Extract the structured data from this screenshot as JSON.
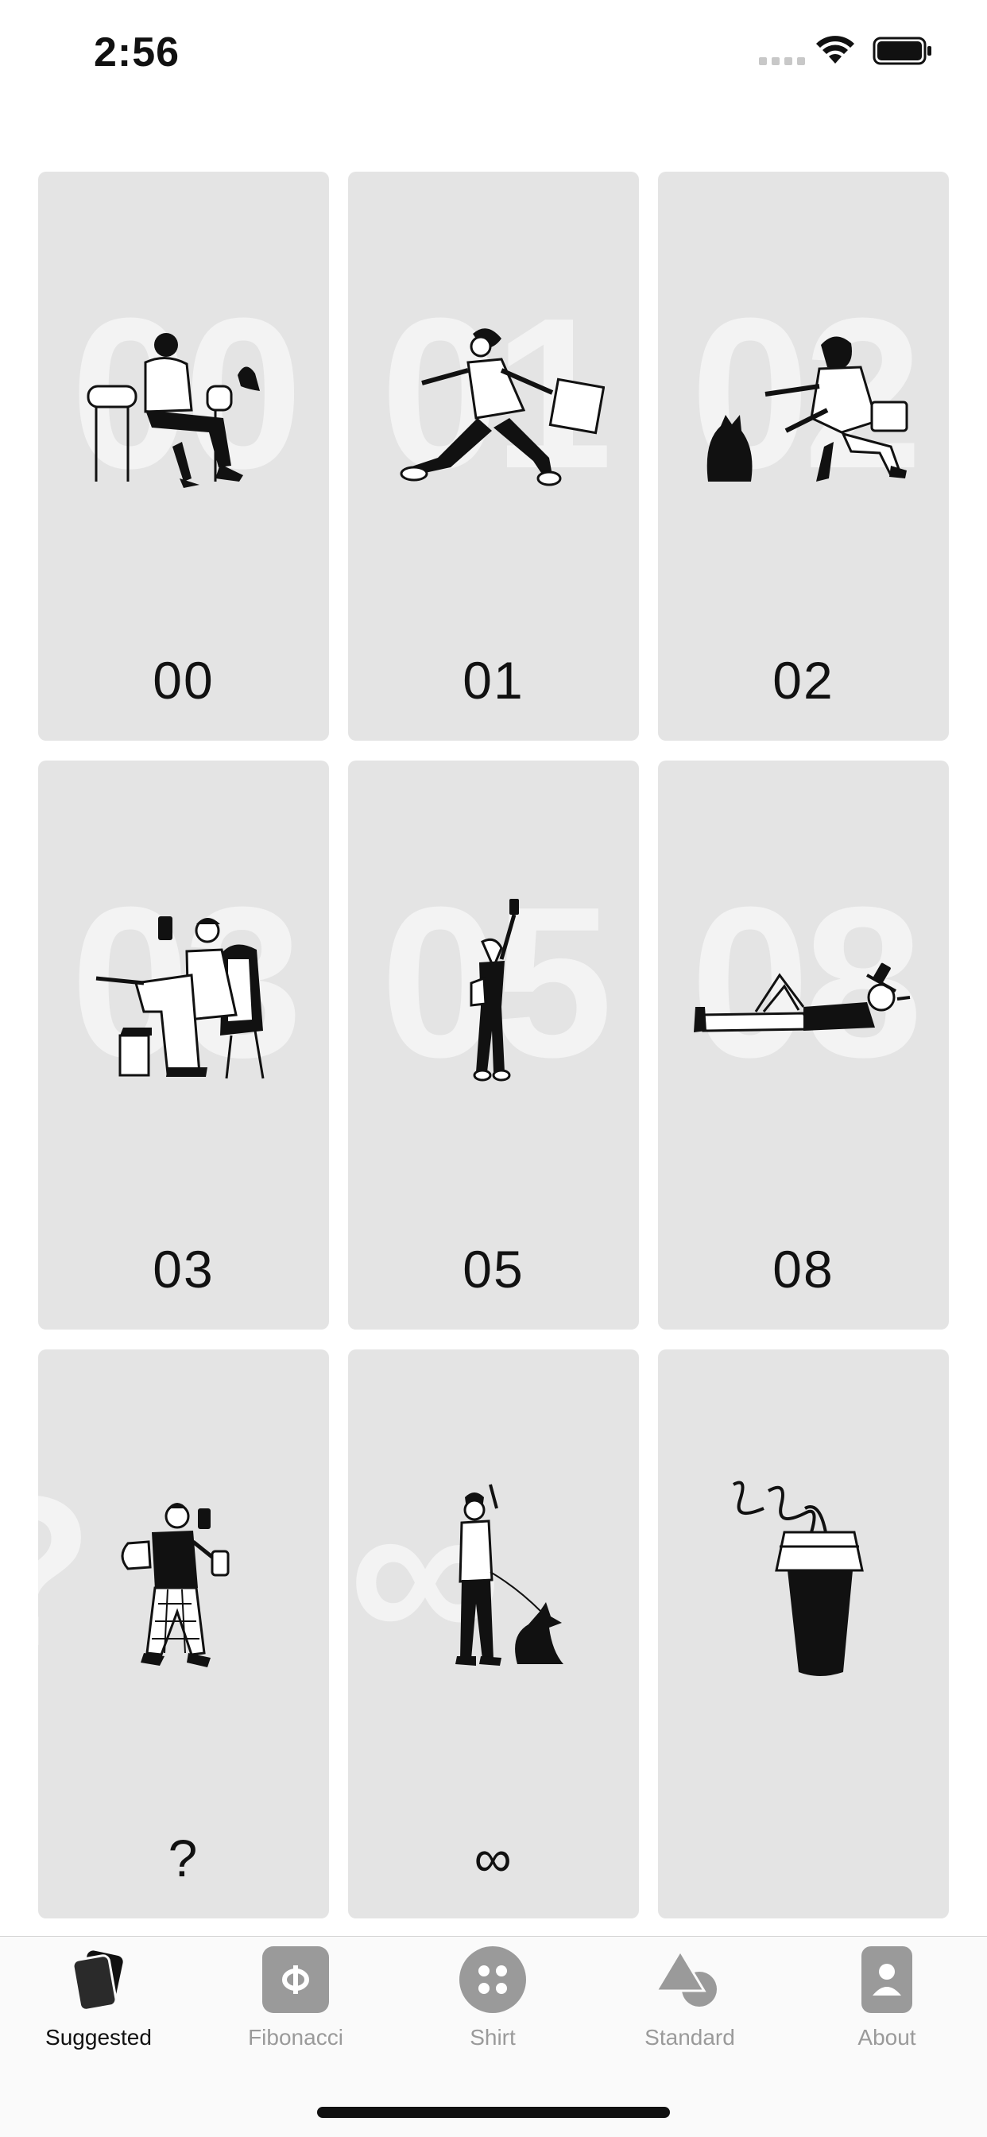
{
  "status": {
    "time": "2:56"
  },
  "cards": [
    {
      "label": "00",
      "ghost": "00",
      "illustration": "person-sitting-chair-bird-icon"
    },
    {
      "label": "01",
      "ghost": "01",
      "illustration": "person-running-shopping-bag-icon"
    },
    {
      "label": "02",
      "ghost": "02",
      "illustration": "person-kneeling-cat-icon"
    },
    {
      "label": "03",
      "ghost": "03",
      "illustration": "person-sitting-phone-icon"
    },
    {
      "label": "05",
      "ghost": "05",
      "illustration": "person-selfie-icon"
    },
    {
      "label": "08",
      "ghost": "08",
      "illustration": "person-lying-phone-icon"
    },
    {
      "label": "?",
      "ghost": "?",
      "illustration": "person-walking-coffee-icon"
    },
    {
      "label": "∞",
      "ghost": "∞",
      "illustration": "person-walking-dog-icon"
    },
    {
      "label": "",
      "ghost": "",
      "illustration": "coffee-cup-steam-icon"
    }
  ],
  "tabs": [
    {
      "label": "Suggested",
      "icon": "cards-icon",
      "active": true
    },
    {
      "label": "Fibonacci",
      "icon": "phi-icon",
      "active": false
    },
    {
      "label": "Shirt",
      "icon": "four-dots-icon",
      "active": false
    },
    {
      "label": "Standard",
      "icon": "triangle-circle-icon",
      "active": false
    },
    {
      "label": "About",
      "icon": "person-icon",
      "active": false
    }
  ],
  "colors": {
    "card": "#e4e4e4",
    "ghost": "#f3f3f3",
    "tab_inactive": "#9a9a9a",
    "tab_active": "#111111"
  }
}
